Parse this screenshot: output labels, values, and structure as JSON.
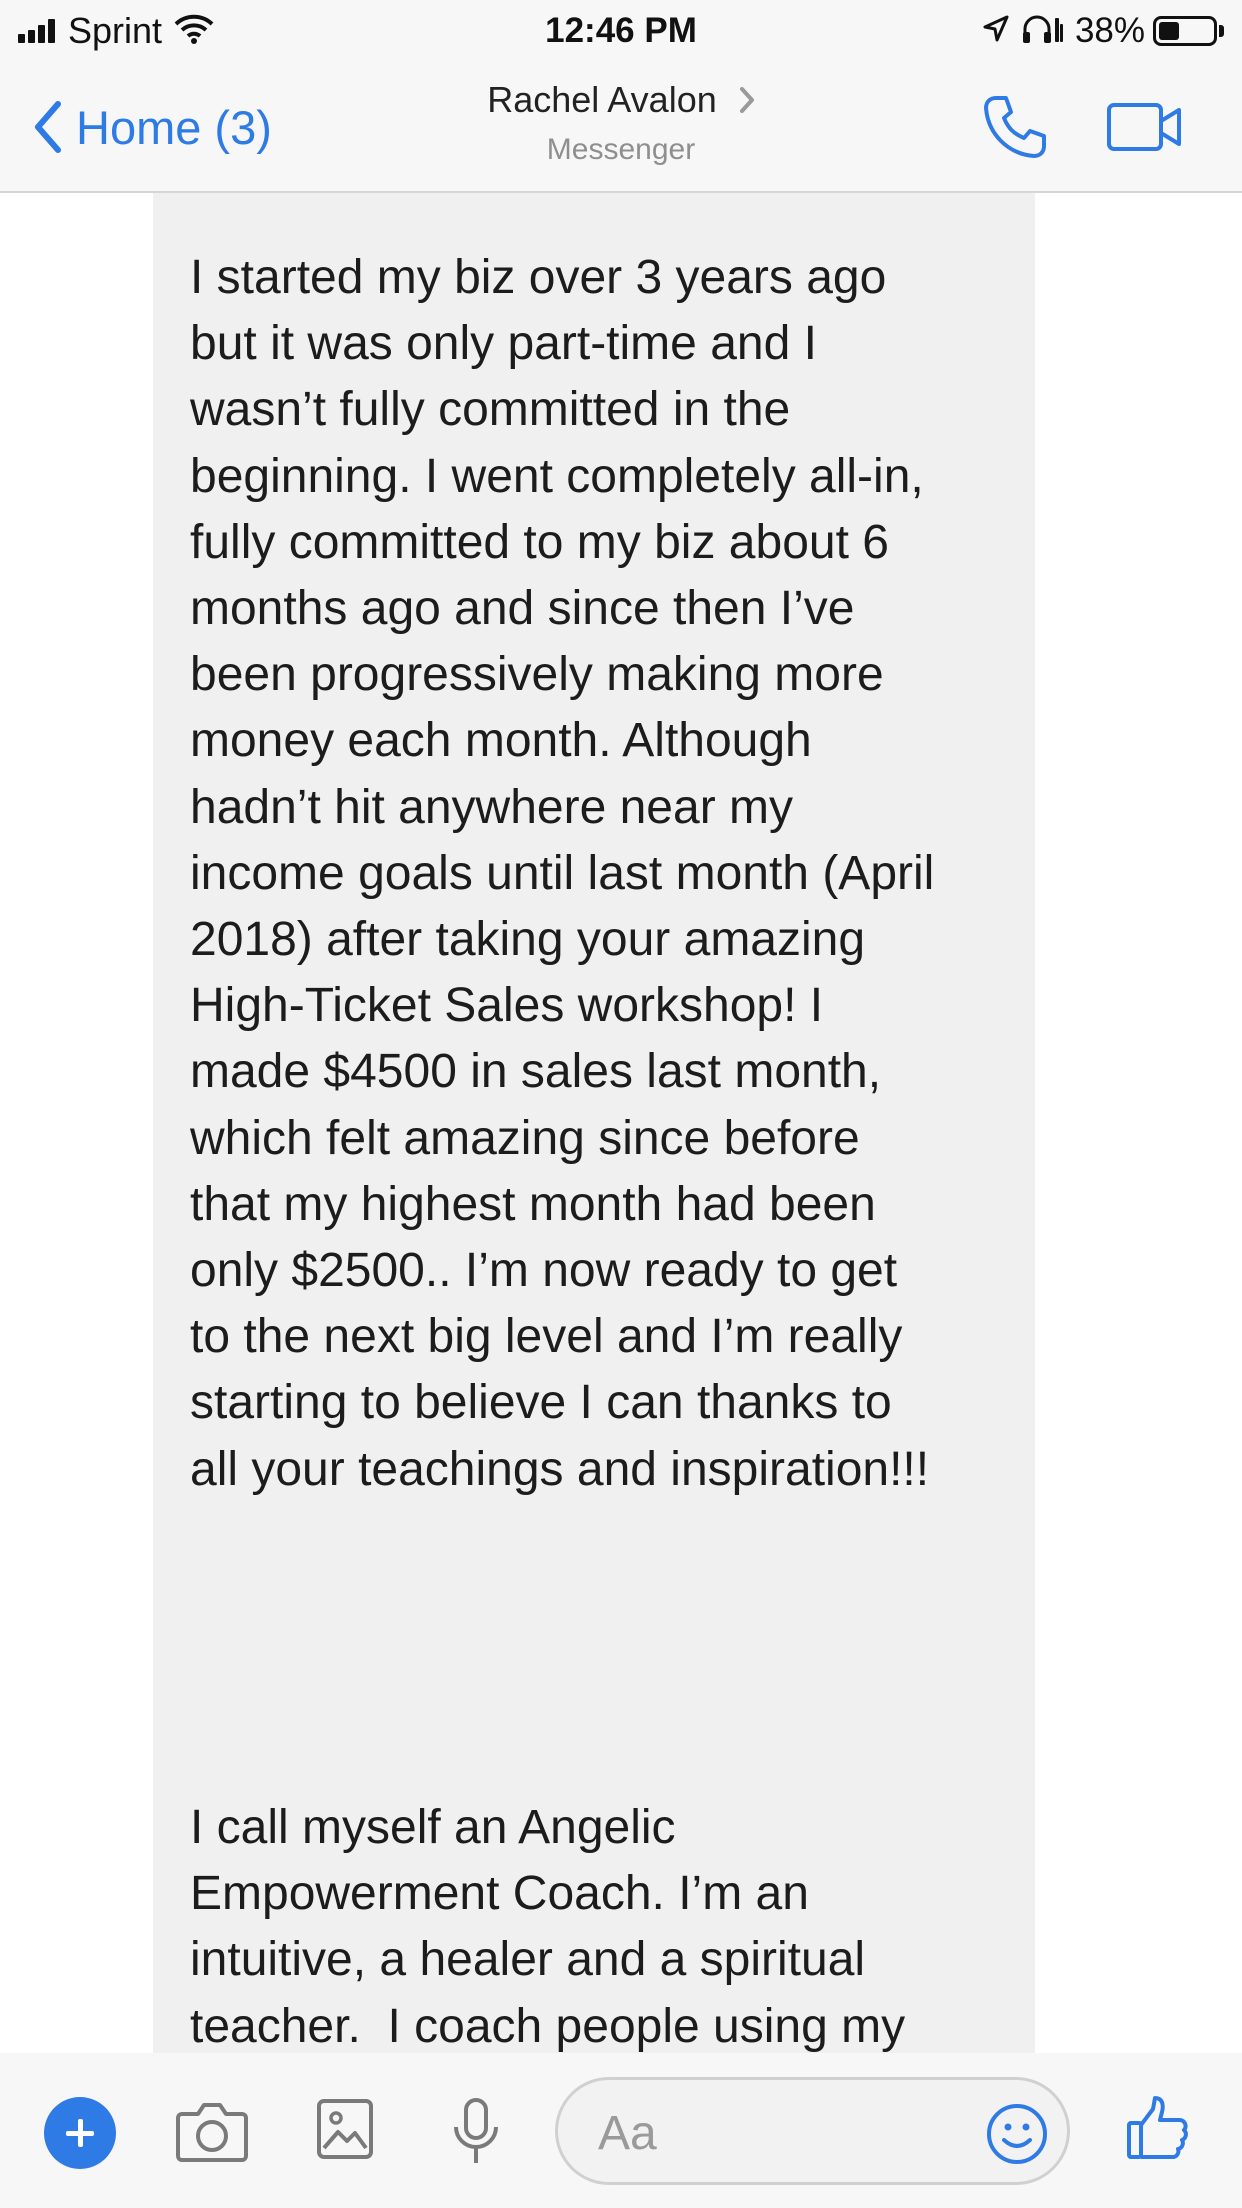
{
  "status_bar": {
    "carrier": "Sprint",
    "time": "12:46 PM",
    "battery_percent": "38%",
    "battery_level": 0.38
  },
  "nav": {
    "back_label": "Home (3)",
    "contact_name": "Rachel Avalon",
    "subtitle": "Messenger",
    "accent_color": "#2f7be6"
  },
  "message": {
    "paragraph_1": "I started my biz over 3 years ago\nbut it was only part-time and I\nwasn’t fully committed in the\nbeginning. I went completely all-in,\nfully committed to my biz about 6\nmonths ago and since then I’ve\nbeen progressively making more\nmoney each month. Although\nhadn’t hit anywhere near my\nincome goals until last month (April\n2018) after taking your amazing\nHigh-Ticket Sales workshop! I\nmade $4500 in sales last month,\nwhich felt amazing since before\nthat my highest month had been\nonly $2500.. I’m now ready to get\nto the next big level and I’m really\nstarting to believe I can thanks to\nall your teachings and inspiration!!!",
    "paragraph_2": "I call myself an Angelic\nEmpowerment Coach. I’m an\nintuitive, a healer and a spiritual\nteacher.  I coach people using my\nchanneling abilities (my main\nspiritual guides are the Angels) and\nhelp them experience a type of"
  },
  "composer": {
    "placeholder": "Aa",
    "icons": [
      "plus-icon",
      "camera-icon",
      "image-icon",
      "microphone-icon",
      "emoji-icon",
      "thumbs-up-icon"
    ]
  }
}
